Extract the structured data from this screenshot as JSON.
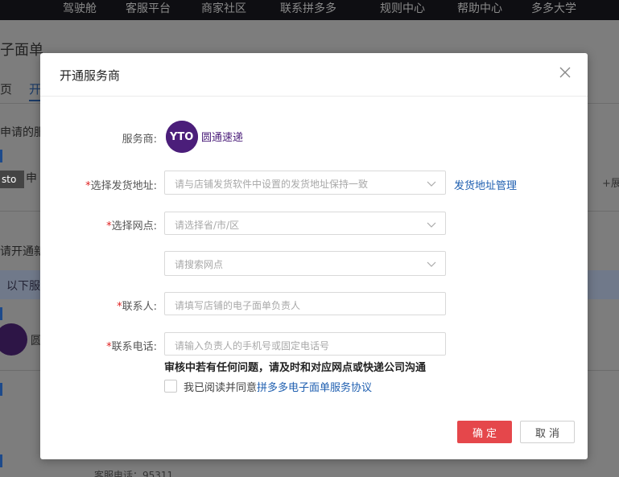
{
  "background": {
    "nav_items": [
      "驾驶舱",
      "客服平台",
      "商家社区",
      "联系拼多多",
      "规则中心",
      "帮助中心",
      "多多大学"
    ],
    "page_title": "子面单",
    "tab_left": "页",
    "tab_active": "开",
    "section_applied": "申请的服",
    "sto_logo": "sto",
    "sto_name": "申",
    "section_open": "请开通新",
    "notice_text": "以下服",
    "yt_name": "圆",
    "expand_label": "+展",
    "service_phone": "客服电话：95311"
  },
  "modal": {
    "title": "开通服务商",
    "provider_label": "服务商:",
    "provider_logo": "YTO",
    "provider_name": "圆通速递",
    "ship_address_label": "选择发货地址:",
    "ship_address_placeholder": "请与店铺发货软件中设置的发货地址保持一致",
    "ship_address_link": "发货地址管理",
    "outlet_label": "选择网点:",
    "region_placeholder": "请选择省/市/区",
    "outlet_search_placeholder": "请搜索网点",
    "contact_label": "联系人:",
    "contact_placeholder": "请填写店铺的电子面单负责人",
    "phone_label": "联系电话:",
    "phone_placeholder": "请输入负责人的手机号或固定电话号",
    "warning_text": "审核中若有任何问题，请及时和对应网点或快递公司沟通",
    "agree_prefix": "我已阅读并同意",
    "agree_link": "拼多多电子面单服务协议",
    "agree_checked": false,
    "required_mark": "*",
    "ok_label": "确定",
    "cancel_label": "取消"
  },
  "colors": {
    "primary_red": "#e5474b",
    "link_blue": "#1f5fb0",
    "yto_purple": "#4b1e7a"
  }
}
